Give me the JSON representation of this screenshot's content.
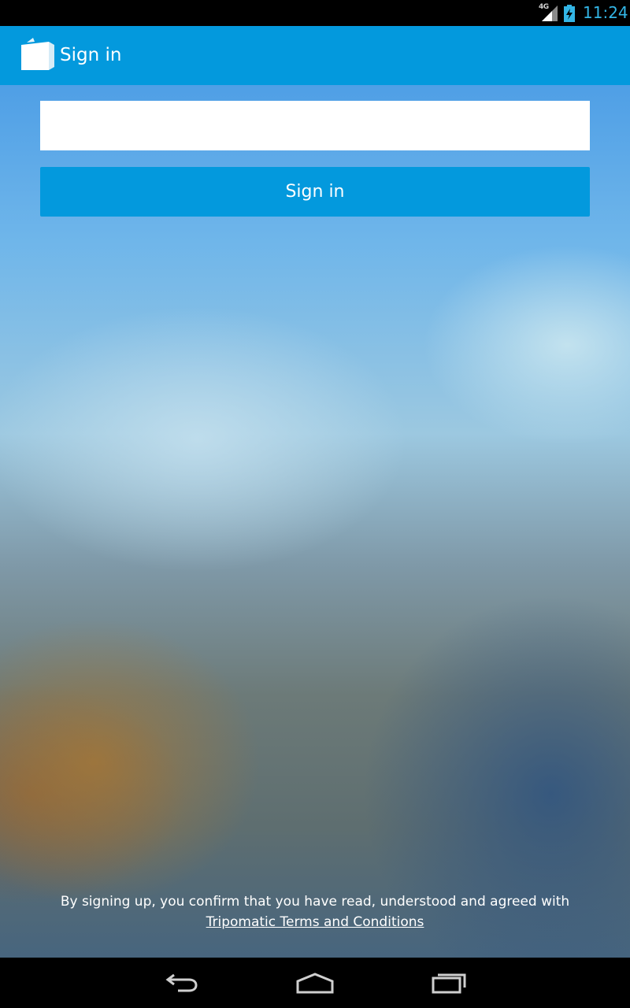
{
  "status_bar": {
    "network": "4G",
    "time": "11:24",
    "icons": [
      "signal-icon",
      "battery-charging-icon"
    ]
  },
  "app_bar": {
    "title": "Sign in",
    "logo_icon": "shopping-bag-logo-icon"
  },
  "form": {
    "email_value": "",
    "email_placeholder": "",
    "submit_label": "Sign in"
  },
  "terms": {
    "text": "By signing up, you confirm that you have read, understood and agreed with",
    "link_label": "Tripomatic Terms and Conditions"
  },
  "nav_bar": {
    "buttons": [
      "back-icon",
      "home-icon",
      "recent-apps-icon"
    ]
  },
  "colors": {
    "accent": "#0399dd",
    "status_text": "#33b5e5"
  }
}
